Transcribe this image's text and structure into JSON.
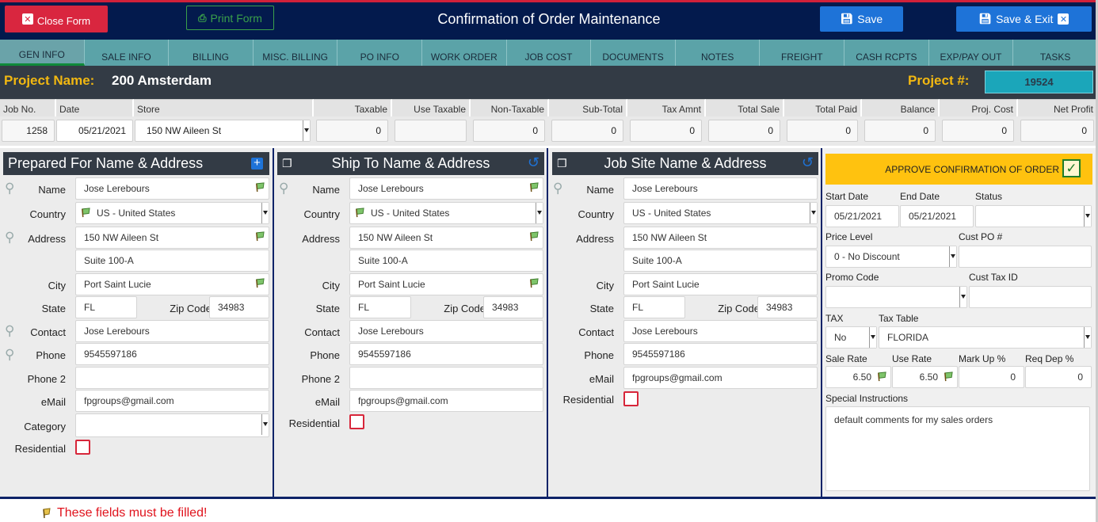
{
  "header": {
    "title": "Confirmation of Order Maintenance",
    "close_label": "Close Form",
    "print_label": "Print Form",
    "save_label": "Save",
    "save_exit_label": "Save & Exit"
  },
  "tabs": [
    "GEN INFO",
    "SALE INFO",
    "BILLING",
    "MISC. BILLING",
    "PO INFO",
    "WORK ORDER",
    "JOB COST",
    "DOCUMENTS",
    "NOTES",
    "FREIGHT",
    "CASH RCPTS",
    "EXP/PAY OUT",
    "TASKS"
  ],
  "project": {
    "name_label": "Project Name:",
    "name": "200 Amsterdam",
    "num_label": "Project #:",
    "num": "19524"
  },
  "summary": {
    "job_no_label": "Job No.",
    "job_no": "1258",
    "date_label": "Date",
    "date": "05/21/2021",
    "store_label": "Store",
    "store": "150 NW Aileen St",
    "cols": [
      {
        "label": "Taxable",
        "value": "0"
      },
      {
        "label": "Use Taxable",
        "value": ""
      },
      {
        "label": "Non-Taxable",
        "value": "0"
      },
      {
        "label": "Sub-Total",
        "value": "0"
      },
      {
        "label": "Tax Amnt",
        "value": "0"
      },
      {
        "label": "Total Sale",
        "value": "0"
      },
      {
        "label": "Total Paid",
        "value": "0"
      },
      {
        "label": "Balance",
        "value": "0"
      },
      {
        "label": "Proj. Cost",
        "value": "0"
      },
      {
        "label": "Net Profit",
        "value": "0"
      }
    ]
  },
  "labels": {
    "name": "Name",
    "country": "Country",
    "address": "Address",
    "city": "City",
    "state": "State",
    "zip": "Zip Code",
    "contact": "Contact",
    "phone": "Phone",
    "phone2": "Phone 2",
    "email": "eMail",
    "category": "Category",
    "residential": "Residential"
  },
  "prepared": {
    "title": "Prepared For Name & Address",
    "name": "Jose Lerebours",
    "country": "US - United States",
    "address1": "150 NW Aileen St",
    "address2": "Suite 100-A",
    "city": "Port Saint Lucie",
    "state": "FL",
    "zip": "34983",
    "contact": "Jose Lerebours",
    "phone": "9545597186",
    "phone2": "",
    "email": "fpgroups@gmail.com",
    "category": ""
  },
  "shipto": {
    "title": "Ship To Name & Address",
    "name": "Jose Lerebours",
    "country": "US - United States",
    "address1": "150 NW Aileen St",
    "address2": "Suite 100-A",
    "city": "Port Saint Lucie",
    "state": "FL",
    "zip": "34983",
    "contact": "Jose Lerebours",
    "phone": "9545597186",
    "phone2": "",
    "email": "fpgroups@gmail.com"
  },
  "jobsite": {
    "title": "Job Site Name & Address",
    "name": "Jose Lerebours",
    "country": "US - United States",
    "address1": "150 NW Aileen St",
    "address2": "Suite 100-A",
    "city": "Port Saint Lucie",
    "state": "FL",
    "zip": "34983",
    "contact": "Jose Lerebours",
    "phone": "9545597186",
    "email": "fpgroups@gmail.com"
  },
  "right": {
    "approve_label": "APPROVE CONFIRMATION OF ORDER",
    "start_date_label": "Start Date",
    "start_date": "05/21/2021",
    "end_date_label": "End Date",
    "end_date": "05/21/2021",
    "status_label": "Status",
    "status": "",
    "price_level_label": "Price Level",
    "price_level": "0 - No Discount",
    "cust_po_label": "Cust PO #",
    "cust_po": "",
    "promo_label": "Promo Code",
    "promo": "",
    "cust_tax_label": "Cust Tax ID",
    "cust_tax": "",
    "tax_label": "TAX",
    "tax": "No",
    "tax_table_label": "Tax Table",
    "tax_table": "FLORIDA",
    "sale_rate_label": "Sale Rate",
    "sale_rate": "6.50",
    "use_rate_label": "Use Rate",
    "use_rate": "6.50",
    "markup_label": "Mark Up %",
    "markup": "0",
    "req_dep_label": "Req Dep %",
    "req_dep": "0",
    "special_label": "Special Instructions",
    "special": "default comments for my sales orders"
  },
  "footer": {
    "note": "These fields must be filled!"
  },
  "colors": {
    "navy": "#031a4d",
    "accent_red": "#d9263f",
    "blue": "#1e73d8",
    "teal": "#5ba3a8",
    "gold": "#f2b811",
    "approve": "#ffc20f"
  }
}
